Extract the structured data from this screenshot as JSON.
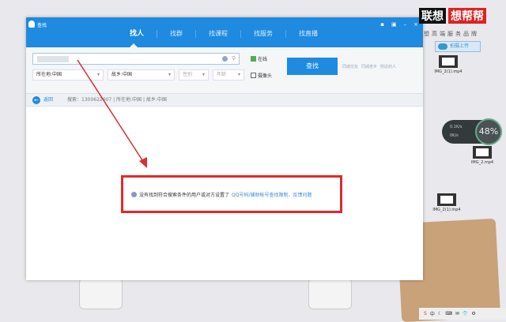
{
  "window": {
    "title": "查找",
    "tabs": [
      "找人",
      "找群",
      "找课程",
      "找服务",
      "找直播"
    ],
    "controls": [
      "▪",
      "▣",
      "–",
      "×"
    ]
  },
  "search": {
    "input_value": "",
    "location": "所在地:中国",
    "hometown": "故乡:中国",
    "gender": "性别",
    "age": "年龄",
    "online_label": "在线",
    "online_checked": true,
    "camera_label": "摄像头",
    "camera_checked": false,
    "button": "查找",
    "links": [
      "同城交友",
      "同城老乡",
      "附近的人"
    ]
  },
  "breadcrumb": {
    "back": "返回",
    "path": "搜索：1300622607 | 所在地:中国 | 故乡:中国"
  },
  "result": {
    "message": "没有找到符合搜索条件的用户或对方设置了",
    "link": "QQ号码/辅助帐号查找限制，反馈问题"
  },
  "desktop": {
    "logo_left": "联想",
    "logo_right": "想帮帮",
    "slogan": "想高端服务品牌",
    "upload": "拍摄上传",
    "files": [
      "IMG_2(1).mp4",
      "IMG_2.mp4",
      "IMG_2(1).mp4"
    ],
    "speed": {
      "up": "0.1K/s",
      "down": "0K/s",
      "percent": "48%"
    }
  },
  "taskbar": {
    "items": [
      "S",
      "中",
      "☾",
      "⌨",
      "✉",
      "👕",
      "⚙"
    ]
  },
  "colors": {
    "accent": "#1e8ae0",
    "highlight": "#e02a2a"
  }
}
